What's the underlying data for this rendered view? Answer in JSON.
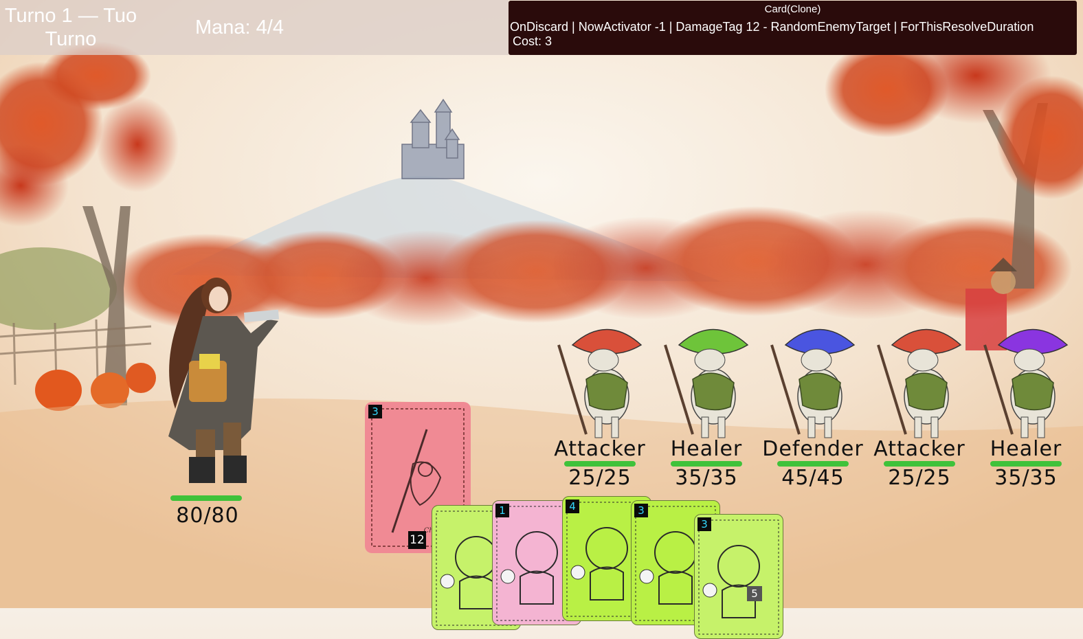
{
  "hud": {
    "turn_label": "Turno 1 — Tuo Turno",
    "mana_label": "Mana: 4/4"
  },
  "tooltip": {
    "title": "Card(Clone)",
    "description": "OnDiscard | NowActivator  -1 | DamageTag 12 - RandomEnemyTarget | ForThisResolveDuration",
    "cost": "Cost: 3"
  },
  "player": {
    "hp": "80/80",
    "hp_fraction": 1.0
  },
  "enemies": [
    {
      "name": "Attacker",
      "hp": "25/25",
      "hp_fraction": 1.0,
      "cap": "#d9503a"
    },
    {
      "name": "Healer",
      "hp": "35/35",
      "hp_fraction": 1.0,
      "cap": "#6ec43a"
    },
    {
      "name": "Defender",
      "hp": "45/45",
      "hp_fraction": 1.0,
      "cap": "#4a55e0"
    },
    {
      "name": "Attacker",
      "hp": "25/25",
      "hp_fraction": 1.0,
      "cap": "#d9503a"
    },
    {
      "name": "Healer",
      "hp": "35/35",
      "hp_fraction": 1.0,
      "cap": "#8a35e0"
    }
  ],
  "selected_card": {
    "cost": "3",
    "damage": "12",
    "signature": "Chayce I",
    "color": "#f08a94"
  },
  "hand": [
    {
      "cost": "",
      "color": "#c6f26a"
    },
    {
      "cost": "1",
      "color": "#f4b4d2"
    },
    {
      "cost": "4",
      "color": "#b9f045"
    },
    {
      "cost": "3",
      "color": "#b9f045"
    },
    {
      "cost": "3",
      "color": "#c6f26a",
      "extra": "5"
    }
  ],
  "colors": {
    "hp_bar": "#3fc23a",
    "tooltip_bg": "#2a0b0b",
    "cost_text": "#33d9ff"
  }
}
